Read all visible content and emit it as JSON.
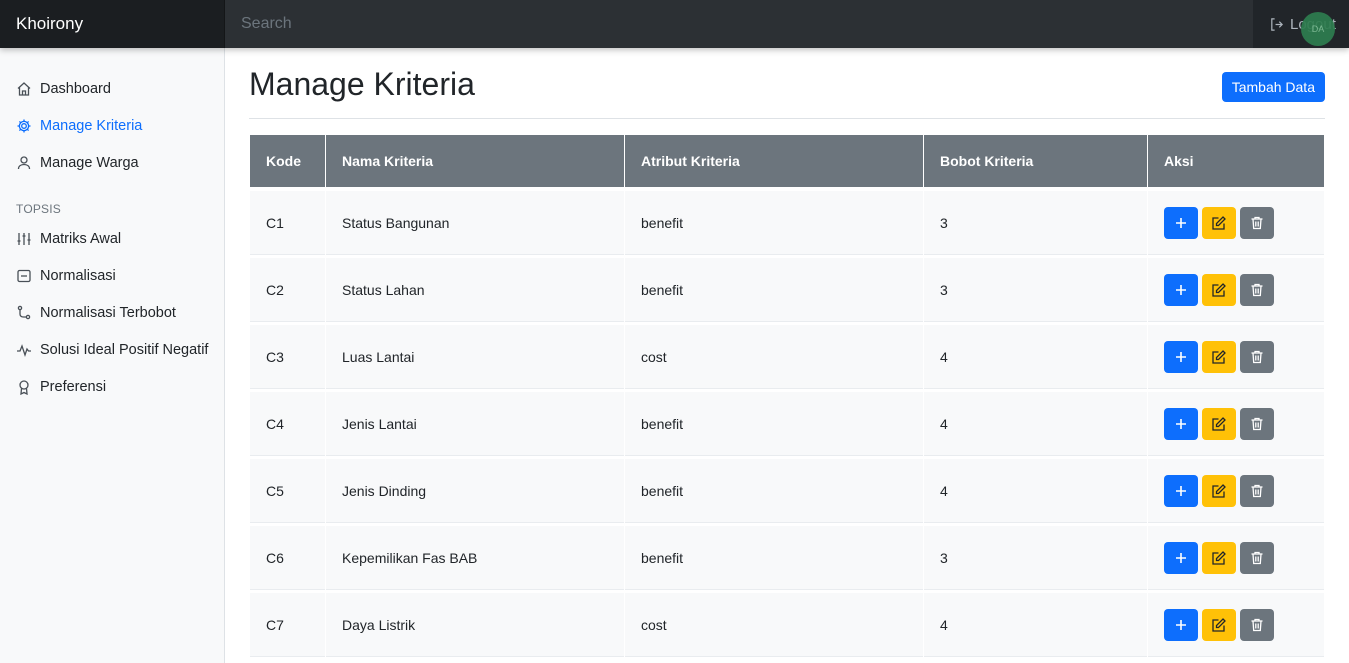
{
  "navbar": {
    "brand": "Khoirony",
    "search_placeholder": "Search",
    "logout_label": "Logout",
    "avatar_text": "DA"
  },
  "sidebar": {
    "items": [
      {
        "label": "Dashboard",
        "icon": "home-icon"
      },
      {
        "label": "Manage Kriteria",
        "icon": "gear-icon",
        "active": true
      },
      {
        "label": "Manage Warga",
        "icon": "person-icon"
      }
    ],
    "section_heading": "TOPSIS",
    "topsis_items": [
      {
        "label": "Matriks Awal",
        "icon": "sliders-icon"
      },
      {
        "label": "Normalisasi",
        "icon": "box-icon"
      },
      {
        "label": "Normalisasi Terbobot",
        "icon": "branch-icon"
      },
      {
        "label": "Solusi Ideal Positif Negatif",
        "icon": "activity-icon"
      },
      {
        "label": "Preferensi",
        "icon": "award-icon"
      }
    ]
  },
  "main": {
    "title": "Manage Kriteria",
    "add_button": "Tambah Data",
    "table": {
      "headers": [
        "Kode",
        "Nama Kriteria",
        "Atribut Kriteria",
        "Bobot Kriteria",
        "Aksi"
      ],
      "rows": [
        {
          "kode": "C1",
          "nama": "Status Bangunan",
          "atribut": "benefit",
          "bobot": "3"
        },
        {
          "kode": "C2",
          "nama": "Status Lahan",
          "atribut": "benefit",
          "bobot": "3"
        },
        {
          "kode": "C3",
          "nama": "Luas Lantai",
          "atribut": "cost",
          "bobot": "4"
        },
        {
          "kode": "C4",
          "nama": "Jenis Lantai",
          "atribut": "benefit",
          "bobot": "4"
        },
        {
          "kode": "C5",
          "nama": "Jenis Dinding",
          "atribut": "benefit",
          "bobot": "4"
        },
        {
          "kode": "C6",
          "nama": "Kepemilikan Fas BAB",
          "atribut": "benefit",
          "bobot": "3"
        },
        {
          "kode": "C7",
          "nama": "Daya Listrik",
          "atribut": "cost",
          "bobot": "4"
        }
      ]
    }
  },
  "colors": {
    "primary": "#0d6efd",
    "warning": "#ffc107",
    "secondary": "#6c757d",
    "dark": "#212529"
  }
}
